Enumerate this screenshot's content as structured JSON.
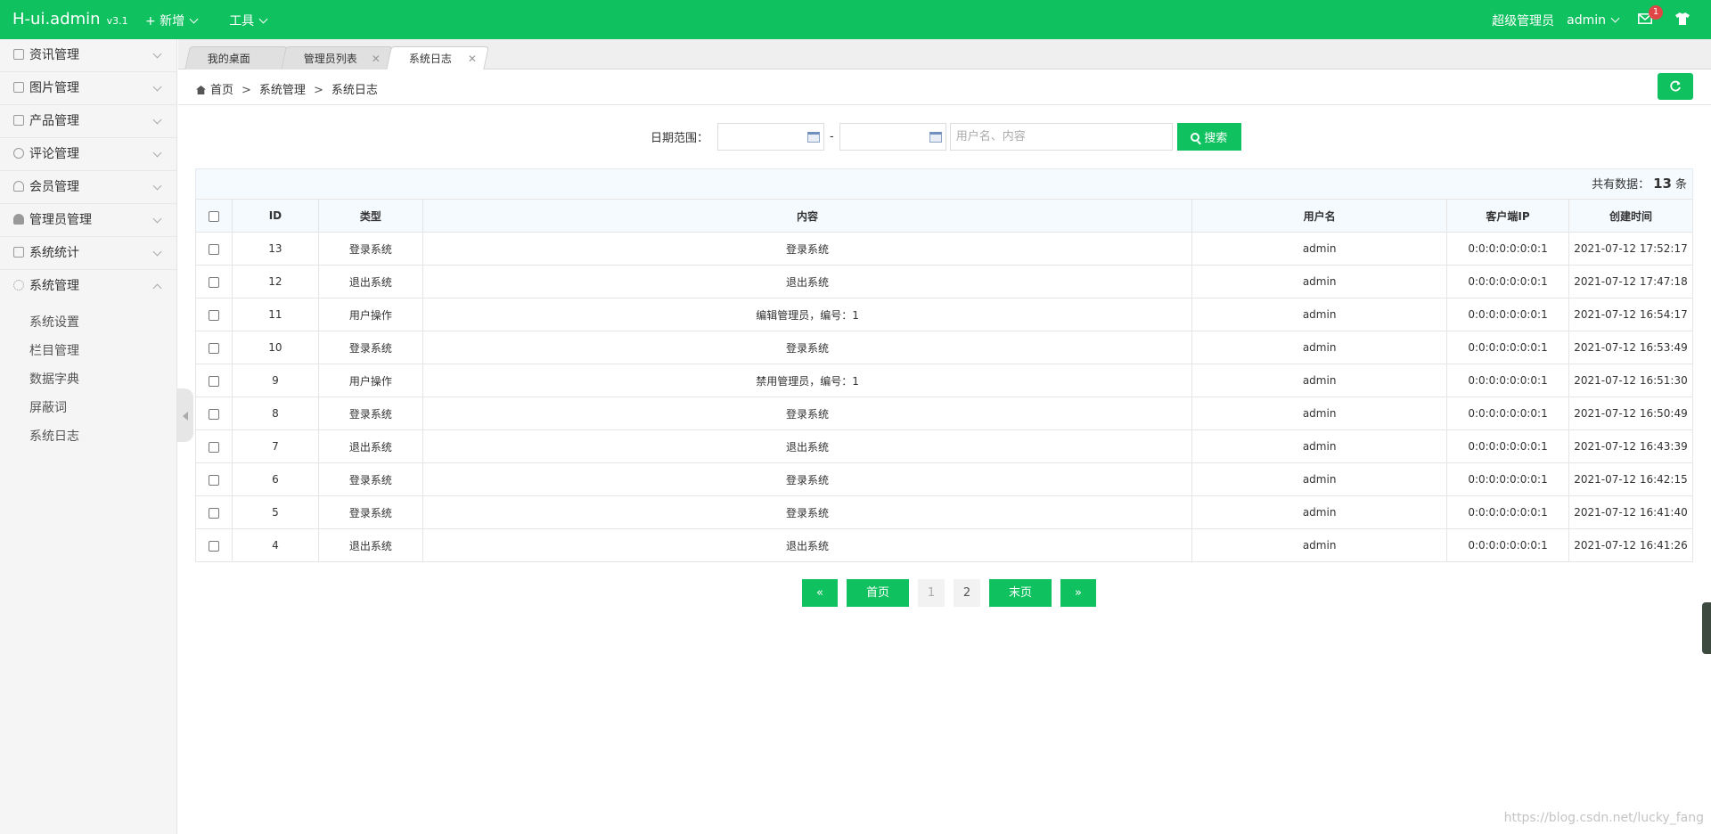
{
  "header": {
    "logo": "H-ui.admin",
    "version": "v3.1",
    "nav": [
      {
        "label": "+ 新增"
      },
      {
        "label": "工具"
      }
    ],
    "role": "超级管理员",
    "user": "admin",
    "msg_count": "1"
  },
  "sidebar": {
    "items": [
      {
        "label": "资讯管理"
      },
      {
        "label": "图片管理"
      },
      {
        "label": "产品管理"
      },
      {
        "label": "评论管理"
      },
      {
        "label": "会员管理"
      },
      {
        "label": "管理员管理"
      },
      {
        "label": "系统统计"
      },
      {
        "label": "系统管理"
      }
    ],
    "sub_items": [
      {
        "label": "系统设置"
      },
      {
        "label": "栏目管理"
      },
      {
        "label": "数据字典"
      },
      {
        "label": "屏蔽词"
      },
      {
        "label": "系统日志"
      }
    ]
  },
  "tabs": [
    {
      "label": "我的桌面"
    },
    {
      "label": "管理员列表"
    },
    {
      "label": "系统日志"
    }
  ],
  "breadcrumb": {
    "home": "首页",
    "sep": ">",
    "level1": "系统管理",
    "level2": "系统日志"
  },
  "search": {
    "label": "日期范围：",
    "dash": "-",
    "placeholder": "用户名、内容",
    "button": "搜索"
  },
  "summary": {
    "prefix": "共有数据：",
    "count": "13",
    "suffix": "条"
  },
  "table": {
    "headers": [
      "ID",
      "类型",
      "内容",
      "用户名",
      "客户端IP",
      "创建时间"
    ],
    "rows": [
      {
        "id": "13",
        "type": "登录系统",
        "content": "登录系统",
        "user": "admin",
        "ip": "0:0:0:0:0:0:0:1",
        "time": "2021-07-12 17:52:17"
      },
      {
        "id": "12",
        "type": "退出系统",
        "content": "退出系统",
        "user": "admin",
        "ip": "0:0:0:0:0:0:0:1",
        "time": "2021-07-12 17:47:18"
      },
      {
        "id": "11",
        "type": "用户操作",
        "content": "编辑管理员，编号：1",
        "user": "admin",
        "ip": "0:0:0:0:0:0:0:1",
        "time": "2021-07-12 16:54:17"
      },
      {
        "id": "10",
        "type": "登录系统",
        "content": "登录系统",
        "user": "admin",
        "ip": "0:0:0:0:0:0:0:1",
        "time": "2021-07-12 16:53:49"
      },
      {
        "id": "9",
        "type": "用户操作",
        "content": "禁用管理员，编号：1",
        "user": "admin",
        "ip": "0:0:0:0:0:0:0:1",
        "time": "2021-07-12 16:51:30"
      },
      {
        "id": "8",
        "type": "登录系统",
        "content": "登录系统",
        "user": "admin",
        "ip": "0:0:0:0:0:0:0:1",
        "time": "2021-07-12 16:50:49"
      },
      {
        "id": "7",
        "type": "退出系统",
        "content": "退出系统",
        "user": "admin",
        "ip": "0:0:0:0:0:0:0:1",
        "time": "2021-07-12 16:43:39"
      },
      {
        "id": "6",
        "type": "登录系统",
        "content": "登录系统",
        "user": "admin",
        "ip": "0:0:0:0:0:0:0:1",
        "time": "2021-07-12 16:42:15"
      },
      {
        "id": "5",
        "type": "登录系统",
        "content": "登录系统",
        "user": "admin",
        "ip": "0:0:0:0:0:0:0:1",
        "time": "2021-07-12 16:41:40"
      },
      {
        "id": "4",
        "type": "退出系统",
        "content": "退出系统",
        "user": "admin",
        "ip": "0:0:0:0:0:0:0:1",
        "time": "2021-07-12 16:41:26"
      }
    ]
  },
  "pager": {
    "prev": "«",
    "first": "首页",
    "pages": [
      "1",
      "2"
    ],
    "last": "末页",
    "next": "»"
  },
  "watermark": "https://blog.csdn.net/lucky_fang",
  "colors": {
    "accent": "#0fc15f"
  }
}
